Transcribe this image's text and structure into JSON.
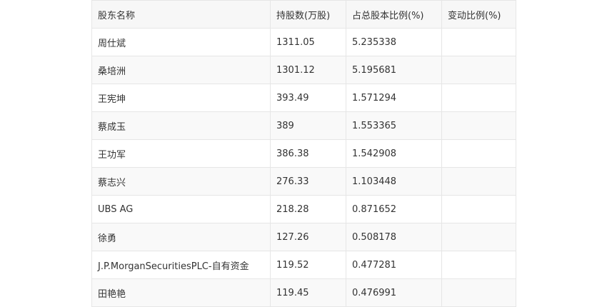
{
  "table": {
    "headers": [
      "股东名称",
      "持股数(万股)",
      "占总股本比例(%)",
      "变动比例(%)"
    ],
    "rows": [
      [
        "周仕斌",
        "1311.05",
        "5.235338",
        ""
      ],
      [
        "桑培洲",
        "1301.12",
        "5.195681",
        ""
      ],
      [
        "王宪坤",
        "393.49",
        "1.571294",
        ""
      ],
      [
        "蔡成玉",
        "389",
        "1.553365",
        ""
      ],
      [
        "王功军",
        "386.38",
        "1.542908",
        ""
      ],
      [
        "蔡志兴",
        "276.33",
        "1.103448",
        ""
      ],
      [
        "UBS AG",
        "218.28",
        "0.871652",
        ""
      ],
      [
        "徐勇",
        "127.26",
        "0.508178",
        ""
      ],
      [
        "J.P.MorganSecuritiesPLC-自有资金",
        "119.52",
        "0.477281",
        ""
      ],
      [
        "田艳艳",
        "119.45",
        "0.476991",
        ""
      ]
    ]
  }
}
